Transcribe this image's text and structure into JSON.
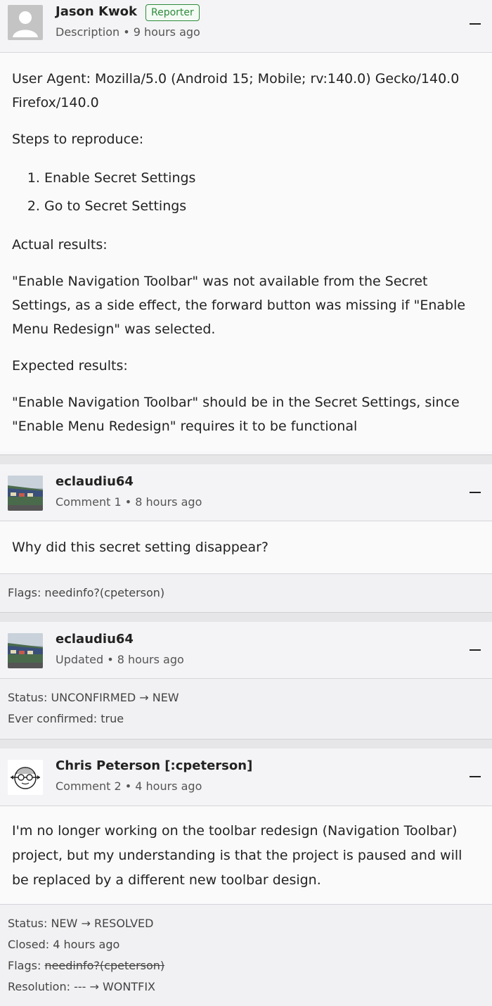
{
  "comments": [
    {
      "author": "Jason Kwok",
      "badge": "Reporter",
      "meta": "Description • 9 hours ago",
      "body": {
        "user_agent": "User Agent: Mozilla/5.0 (Android 15; Mobile; rv:140.0) Gecko/140.0 Firefox/140.0",
        "steps_heading": "Steps to reproduce:",
        "steps": [
          "Enable Secret Settings",
          "Go to Secret Settings"
        ],
        "actual_heading": "Actual results:",
        "actual_text": "\"Enable Navigation Toolbar\" was not available from the Secret Settings, as a side effect, the forward button was missing if \"Enable Menu Redesign\" was selected.",
        "expected_heading": "Expected results:",
        "expected_text": "\"Enable Navigation Toolbar\" should be in the Secret Settings, since \"Enable Menu Redesign\" requires it to be functional"
      }
    },
    {
      "author": "eclaudiu64",
      "meta": "Comment 1 • 8 hours ago",
      "body_text": "Why did this secret setting disappear?",
      "changes": {
        "flags": "Flags: needinfo?(cpeterson)"
      }
    },
    {
      "author": "eclaudiu64",
      "meta": "Updated • 8 hours ago",
      "changes": {
        "status": "Status: UNCONFIRMED → NEW",
        "ever_confirmed": "Ever confirmed: true"
      }
    },
    {
      "author": "Chris Peterson [:cpeterson]",
      "meta": "Comment 2 • 4 hours ago",
      "body_text": "I'm no longer working on the toolbar redesign (Navigation Toolbar) project, but my understanding is that the project is paused and will be replaced by a different new toolbar design.",
      "changes": {
        "status": "Status: NEW → RESOLVED",
        "closed": "Closed: 4 hours ago",
        "flags_label": "Flags: ",
        "flags_struck": "needinfo?(cpeterson)",
        "resolution": "Resolution: --- → WONTFIX"
      }
    }
  ],
  "colors": {
    "reporter_badge": "#2e8b3a",
    "background": "#e6e6e8",
    "card": "#f7f7f9"
  },
  "icons": {
    "default_avatar": "user-placeholder-icon",
    "collapse": "minus-icon"
  }
}
